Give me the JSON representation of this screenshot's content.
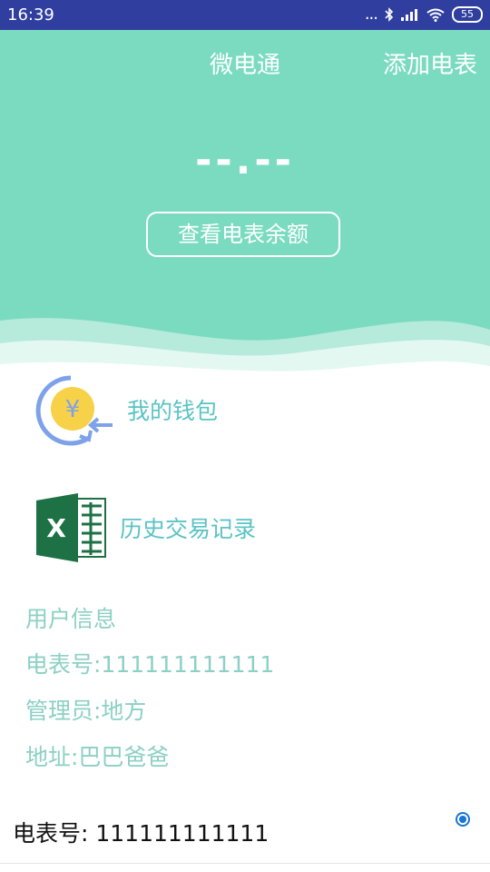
{
  "status_bar": {
    "time": "16:39",
    "signal_dots": "...",
    "battery": "55"
  },
  "header": {
    "app_title": "微电通",
    "add_meter_label": "添加电表",
    "balance_placeholder": "--.--",
    "view_balance_label": "查看电表余额",
    "color": "#7BDBC0"
  },
  "menu": {
    "wallet_label": "我的钱包",
    "history_label": "历史交易记录"
  },
  "user_info": {
    "title": "用户信息",
    "meter_no": "电表号:111111111111",
    "manager": "管理员:地方",
    "address": "地址:巴巴爸爸"
  },
  "meter_list": [
    {
      "label": "电表号: 111111111111",
      "selected": true
    }
  ]
}
